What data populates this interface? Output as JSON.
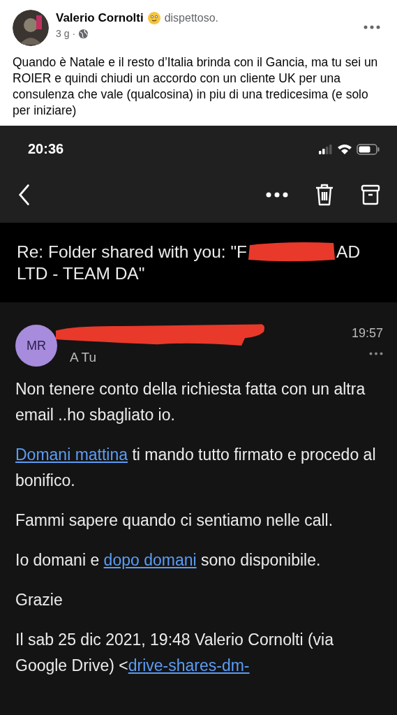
{
  "post": {
    "author": "Valerio Cornolti",
    "feeling": "dispettoso.",
    "time": "3 g",
    "separator": "·",
    "text": "Quando è Natale e il resto d’Italia brinda con il Gancia, ma tu sei un ROIER e quindi chiudi un accordo con un cliente UK per una consulenza che vale (qualcosina) in piu di una tredicesima (e solo per iniziare)"
  },
  "phone": {
    "clock": "20:36"
  },
  "email": {
    "subject_before": "Re: Folder shared with you: \"F",
    "subject_after": "AD LTD - TEAM DA\"",
    "avatar_initials": "MR",
    "recipient": "A Tu",
    "time": "19:57",
    "paragraphs": [
      [
        {
          "kind": "text",
          "text": "Non tenere conto della richiesta fatta con un altra email ..ho sbagliato io."
        }
      ],
      [
        {
          "kind": "link",
          "text": "Domani mattina"
        },
        {
          "kind": "text",
          "text": " ti mando tutto firmato e procedo al bonifico."
        }
      ],
      [
        {
          "kind": "text",
          "text": "Fammi sapere quando ci sentiamo nelle call."
        }
      ],
      [
        {
          "kind": "text",
          "text": "Io domani e "
        },
        {
          "kind": "link",
          "text": "dopo domani"
        },
        {
          "kind": "text",
          "text": " sono disponibile."
        }
      ],
      [
        {
          "kind": "text",
          "text": "Grazie"
        }
      ],
      [
        {
          "kind": "text",
          "text": "Il sab 25 dic 2021, 19:48 Valerio Cornolti (via Google Drive) <"
        },
        {
          "kind": "link",
          "text": "drive-shares-dm-"
        }
      ]
    ]
  }
}
